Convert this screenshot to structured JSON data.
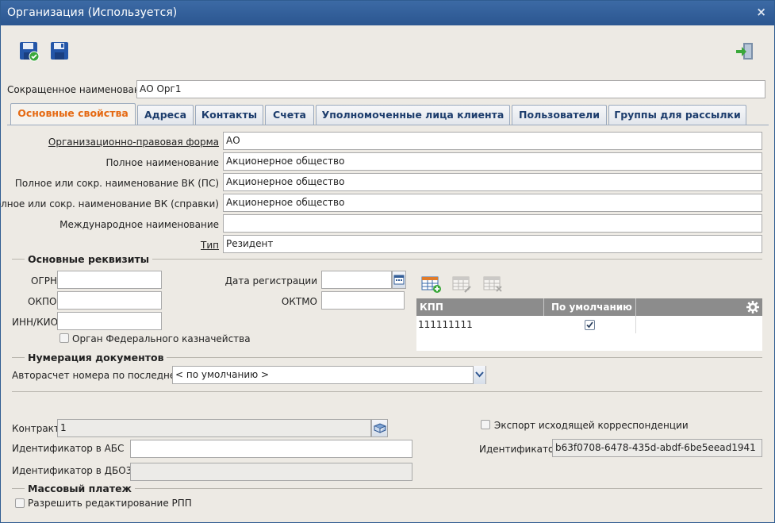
{
  "window": {
    "title": "Организация (Используется)",
    "close_glyph": "×"
  },
  "toolbar": {
    "save_close_icon": "save-and-close-icon",
    "save_icon": "save-icon",
    "exit_icon": "exit-icon"
  },
  "short_name": {
    "label": "Сокращенное наименование",
    "value": "АО Орг1"
  },
  "tabs": [
    {
      "label": "Основные свойства",
      "active": true
    },
    {
      "label": "Адреса"
    },
    {
      "label": "Контакты"
    },
    {
      "label": "Счета"
    },
    {
      "label": "Уполномоченные лица клиента"
    },
    {
      "label": "Пользователи"
    },
    {
      "label": "Группы для рассылки"
    }
  ],
  "fields": {
    "legal_form": {
      "label": "Организационно-правовая форма",
      "value": "АО"
    },
    "full_name": {
      "label": "Полное наименование",
      "value": "Акционерное общество"
    },
    "vk_ps": {
      "label": "Полное или сокр. наименование ВК (ПС)",
      "value": "Акционерное общество"
    },
    "vk_ref": {
      "label": "Полное или сокр. наименование ВК (справки)",
      "value": "Акционерное общество"
    },
    "intl_name": {
      "label": "Международное наименование",
      "value": ""
    },
    "type": {
      "label": "Тип",
      "value": "Резидент"
    }
  },
  "requisites": {
    "section_title": "Основные реквизиты",
    "ogrn": {
      "label": "ОГРН",
      "value": ""
    },
    "okpo": {
      "label": "ОКПО",
      "value": ""
    },
    "inn": {
      "label": "ИНН/КИО",
      "value": ""
    },
    "reg_date": {
      "label": "Дата регистрации",
      "value": ""
    },
    "oktmo": {
      "label": "ОКТМО",
      "value": ""
    },
    "treasury": {
      "label": "Орган Федерального казначейства",
      "checked": false
    }
  },
  "kpp_grid": {
    "columns": [
      "КПП",
      "По умолчанию"
    ],
    "rows": [
      {
        "kpp": "111111111",
        "default": true
      }
    ]
  },
  "numbering": {
    "section_title": "Нумерация документов",
    "autocalc_label": "Авторасчет номера по последнему",
    "autocalc_value": "< по умолчанию >"
  },
  "bottom": {
    "contract": {
      "label": "Контракт",
      "value": "1"
    },
    "abs_id": {
      "label": "Идентификатор в АБС",
      "value": ""
    },
    "dbo3_id": {
      "label": "Идентификатор в ДБО3",
      "value": ""
    },
    "export_outgoing": {
      "label": "Экспорт исходящей корреспонденции",
      "checked": false
    },
    "identifier": {
      "label": "Идентификатор",
      "value": "b63f0708-6478-435d-abdf-6be5eead1941"
    }
  },
  "mass_payment": {
    "section_title": "Массовый платеж",
    "allow_edit_rpp": {
      "label": "Разрешить редактирование РПП",
      "checked": false
    }
  },
  "colors": {
    "titlebar": "#2f5c91",
    "active_tab_text": "#e56a14",
    "tab_text": "#1d3d6d",
    "grid_header": "#8c8c8c"
  }
}
